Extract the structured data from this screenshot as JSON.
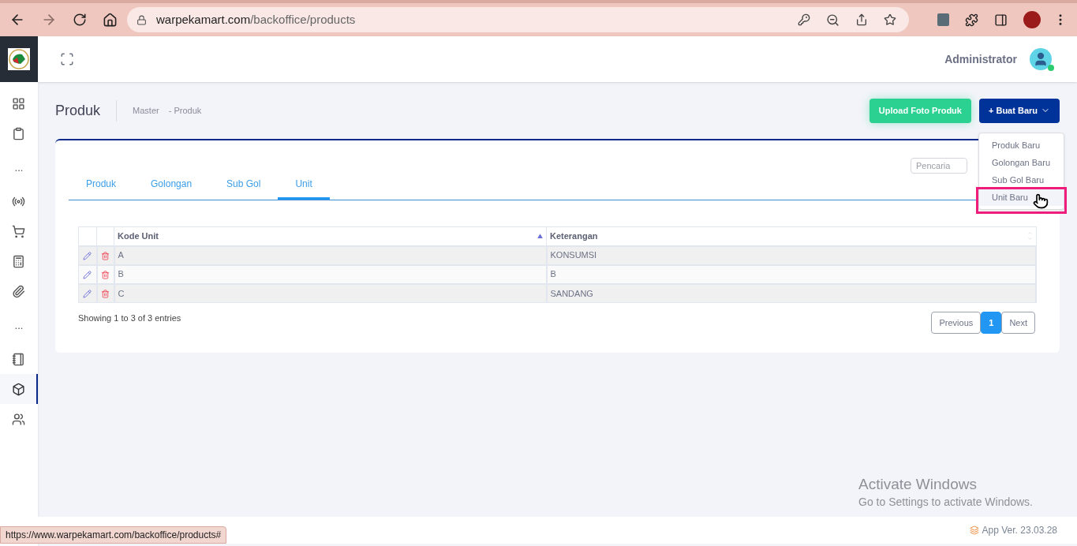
{
  "browser": {
    "url_host": "warpekamart.com",
    "url_path": "/backoffice/products",
    "status_link": "https://www.warpekamart.com/backoffice/products#"
  },
  "sidebar": {
    "items": [
      {
        "kind": "icon",
        "selected": false
      },
      {
        "kind": "icon",
        "selected": false
      },
      {
        "kind": "dots",
        "label": "..."
      },
      {
        "kind": "icon",
        "selected": false
      },
      {
        "kind": "icon",
        "selected": false
      },
      {
        "kind": "icon",
        "selected": false
      },
      {
        "kind": "icon",
        "selected": false
      },
      {
        "kind": "dots",
        "label": "..."
      },
      {
        "kind": "icon",
        "selected": false
      },
      {
        "kind": "icon",
        "selected": true
      },
      {
        "kind": "icon",
        "selected": false
      }
    ]
  },
  "header": {
    "user_name": "Administrator",
    "online": true
  },
  "page": {
    "title": "Produk",
    "breadcrumb": [
      "Master",
      "- Produk"
    ],
    "buttons": {
      "upload": "Upload Foto Produk",
      "create": "+ Buat Baru"
    },
    "create_menu": {
      "open": true,
      "items": [
        {
          "label": "Produk Baru",
          "selected": false
        },
        {
          "label": "Golongan Baru",
          "selected": false
        },
        {
          "label": "Sub Gol Baru",
          "selected": false
        },
        {
          "label": "Unit Baru",
          "selected": true
        }
      ]
    }
  },
  "card": {
    "tabs": [
      {
        "label": "Produk",
        "selected": false
      },
      {
        "label": "Golongan",
        "selected": false
      },
      {
        "label": "Sub Gol",
        "selected": false
      },
      {
        "label": "Unit",
        "selected": true
      }
    ],
    "search": {
      "placeholder": "Pencaria"
    },
    "table": {
      "columns": [
        {
          "label": "Kode Unit",
          "sorted": true
        },
        {
          "label": "Keterangan",
          "sorted": false
        }
      ],
      "rows": [
        {
          "cells": [
            "A",
            "KONSUMSI"
          ]
        },
        {
          "cells": [
            "B",
            "B"
          ]
        },
        {
          "cells": [
            "C",
            "SANDANG"
          ]
        }
      ]
    },
    "info": "Showing 1 to 3 of 3 entries",
    "pagination": [
      {
        "label": "Previous",
        "selected": false
      },
      {
        "label": "1",
        "selected": true
      },
      {
        "label": "Next",
        "selected": false
      }
    ]
  },
  "os_notice": {
    "title": "Activate Windows",
    "text": "Go to Settings to activate Windows."
  },
  "footer": {
    "version": "App Ver. 23.03.28"
  }
}
